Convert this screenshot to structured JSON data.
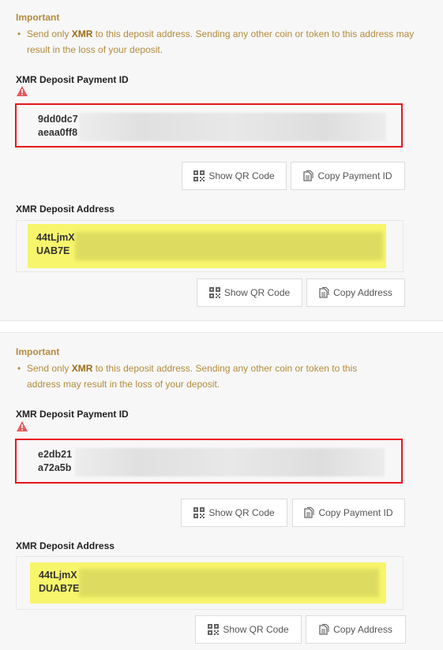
{
  "panels": [
    {
      "important_title": "Important",
      "notice_prefix": "Send only ",
      "notice_coin": "XMR",
      "notice_suffix": " to this deposit address. Sending any other coin or token to this address may result in the loss of your deposit.",
      "payment_id_label": "XMR Deposit Payment ID",
      "payment_id_line1": "9dd0dc7",
      "payment_id_line2": "aeaa0ff8",
      "address_label": "XMR Deposit Address",
      "address_line1": "44tLjmX",
      "address_line2": "UAB7E",
      "buttons": {
        "show_qr_id": "Show QR Code",
        "copy_payment_id": "Copy Payment ID",
        "show_qr_address": "Show QR Code",
        "copy_address": "Copy Address"
      }
    },
    {
      "important_title": "Important",
      "notice_prefix": "Send only ",
      "notice_coin": "XMR",
      "notice_suffix": " to this deposit address. Sending any other coin or token to this address may result in the loss of your deposit.",
      "payment_id_label": "XMR Deposit Payment ID",
      "payment_id_line1": "e2db21",
      "payment_id_line2": "a72a5b",
      "address_label": "XMR Deposit Address",
      "address_line1": "44tLjmX",
      "address_line2": "DUAB7E",
      "buttons": {
        "show_qr_id": "Show QR Code",
        "copy_payment_id": "Copy Payment ID",
        "show_qr_address": "Show QR Code",
        "copy_address": "Copy Address"
      }
    }
  ],
  "colors": {
    "important": "#b38b3c",
    "error_border": "#e8141e",
    "warning_icon": "#e8585e",
    "highlight": "#f7f56b"
  },
  "icons": {
    "warning": "warning-triangle-icon",
    "qr": "qr-code-icon",
    "copy": "copy-document-icon"
  }
}
